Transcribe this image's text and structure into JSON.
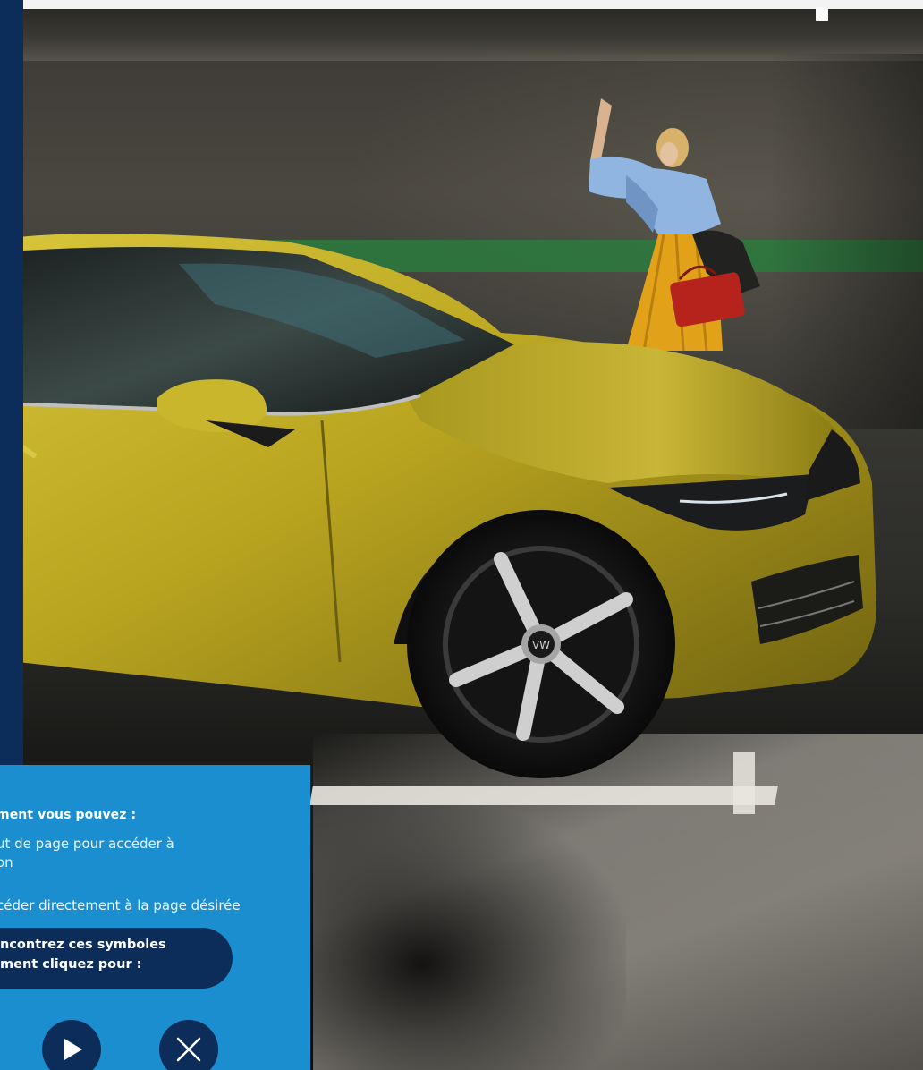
{
  "info_panel": {
    "heading": "ment vous pouvez :",
    "line_1a": "ut de page pour accéder à",
    "line_1b": "on",
    "line_2": "céder directement à la page désirée",
    "symbols_note": {
      "line_1": "ncontrez ces symboles",
      "line_2": "ment cliquez pour :"
    },
    "buttons": {
      "play_icon": "play-icon",
      "close_icon": "close-icon"
    }
  },
  "hero": {
    "subject": "car-photo",
    "logo": "VW"
  },
  "colors": {
    "navy": "#0c2d5a",
    "panel_blue": "#1b8ed0",
    "car_yellow": "#b8a41c",
    "stripe_green": "#2a7a3d"
  }
}
